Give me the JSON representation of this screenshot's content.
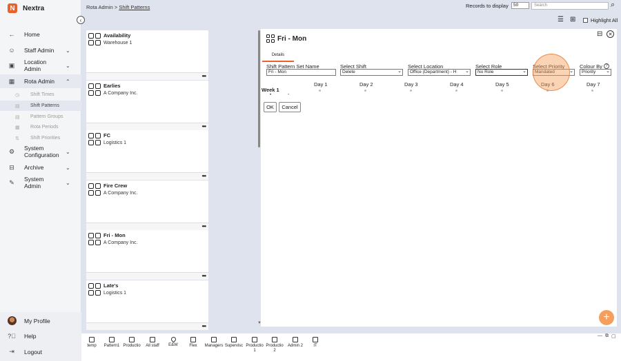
{
  "app": {
    "name": "Nextra",
    "logo_letter": "N",
    "accent": "#e8622c"
  },
  "sidebar": {
    "items": [
      {
        "label": "Home",
        "icon": "arrow-left-icon"
      },
      {
        "label": "Staff Admin",
        "icon": "staff-icon"
      },
      {
        "label": "Location Admin",
        "icon": "location-icon"
      },
      {
        "label": "Rota Admin",
        "icon": "calendar-icon"
      },
      {
        "label": "System Configuration",
        "icon": "gear-icon"
      },
      {
        "label": "Archive",
        "icon": "archive-icon"
      },
      {
        "label": "System Admin",
        "icon": "wrench-icon"
      }
    ],
    "sub_items": [
      {
        "label": "Shift Times"
      },
      {
        "label": "Shift Patterns"
      },
      {
        "label": "Pattern Groups"
      },
      {
        "label": "Rota Periods"
      },
      {
        "label": "Shift Priorities"
      }
    ],
    "bottom": [
      {
        "label": "My Profile"
      },
      {
        "label": "Help"
      },
      {
        "label": "Logout"
      }
    ]
  },
  "topbar": {
    "breadcrumb_root": "Rota Admin >",
    "breadcrumb_current": "Shift Patterns",
    "records_label": "Records to display",
    "records_value": "50",
    "search_placeholder": "Search",
    "highlight_label": "Highlight All"
  },
  "cards": [
    {
      "title": "Availability",
      "subtitle": "Warehouse 1"
    },
    {
      "title": "Earlies",
      "subtitle": "A Company Inc."
    },
    {
      "title": "FC",
      "subtitle": "Logistics 1"
    },
    {
      "title": "Fire Crew",
      "subtitle": "A Company Inc."
    },
    {
      "title": "Fri - Mon",
      "subtitle": "A Company Inc."
    },
    {
      "title": "Late's",
      "subtitle": "Logistics 1"
    }
  ],
  "detail": {
    "title": "Fri - Mon",
    "tab": "Details",
    "fields": {
      "name_label": "Shift Pattern Set Name",
      "name_value": "Fri - Mon",
      "shift_label": "Select Shift",
      "shift_value": "Delete",
      "location_label": "Select Location",
      "location_value": "Office (Department) - H",
      "role_label": "Select Role",
      "role_value": "No Role",
      "priority_label": "Select Priority",
      "priority_value": "Mandated",
      "colour_label": "Colour By",
      "colour_value": "Priority"
    },
    "week_label": "Week 1",
    "days": [
      "Day 1",
      "Day 2",
      "Day 3",
      "Day 4",
      "Day 5",
      "Day 6",
      "Day 7"
    ],
    "ok_label": "OK",
    "cancel_label": "Cancel"
  },
  "taskbar": [
    {
      "label": "temp"
    },
    {
      "label": "Pattern1"
    },
    {
      "label": "Productio"
    },
    {
      "label": "All staff"
    },
    {
      "label": "E&W"
    },
    {
      "label": "Flex"
    },
    {
      "label": "Managers"
    },
    {
      "label": "Supervisc"
    },
    {
      "label": "Productio 1"
    },
    {
      "label": "Productio 2"
    },
    {
      "label": "Admin 2"
    },
    {
      "label": "IT"
    }
  ]
}
